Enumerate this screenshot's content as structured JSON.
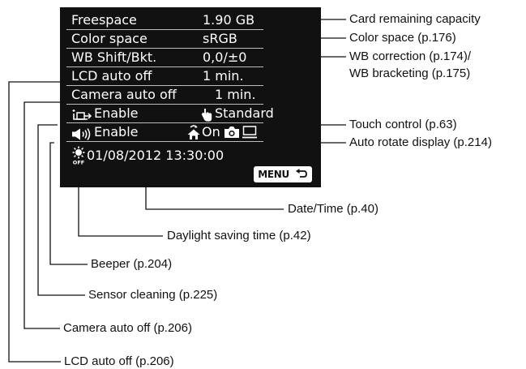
{
  "screen": {
    "rows": [
      {
        "label": "Freespace",
        "value": "1.90 GB"
      },
      {
        "label": "Color space",
        "value": "sRGB"
      },
      {
        "label": "WB Shift/Bkt.",
        "value": "0,0/±0"
      },
      {
        "label": "LCD auto off",
        "value": "1 min."
      },
      {
        "label": "Camera auto off",
        "value": "1 min."
      }
    ],
    "sensor_cleaning": "Enable",
    "touch_control": "Standard",
    "beeper": "Enable",
    "auto_rotate": "On",
    "datetime": "01/08/2012 13:30:00",
    "menu_button": "MENU"
  },
  "captions": {
    "card_capacity": "Card remaining capacity",
    "color_space": "Color space (p.176)",
    "wb_line1": "WB correction (p.174)/",
    "wb_line2": "WB bracketing (p.175)",
    "touch_control": "Touch control (p.63)",
    "auto_rotate": "Auto rotate display (p.214)",
    "datetime": "Date/Time (p.40)",
    "daylight": "Daylight saving time (p.42)",
    "beeper": "Beeper (p.204)",
    "sensor_cleaning": "Sensor cleaning (p.225)",
    "camera_auto_off": "Camera auto off (p.206)",
    "lcd_auto_off": "LCD auto off (p.206)"
  },
  "colors": {
    "screen_bg": "#111111",
    "text": "#ffffff",
    "leader": "#111111"
  },
  "icons": [
    "sensor-cleaning-icon",
    "beeper-icon",
    "touch-hand-icon",
    "auto-rotate-icon",
    "camera-icon",
    "monitor-icon",
    "daylight-saving-icon",
    "return-arrow-icon"
  ]
}
